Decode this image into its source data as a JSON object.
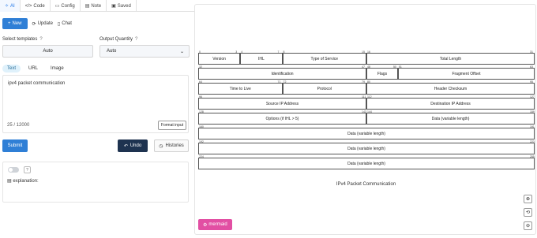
{
  "tabs": [
    {
      "label": "AI",
      "icon": "sparkle-icon"
    },
    {
      "label": "Code",
      "icon": "code-icon"
    },
    {
      "label": "Config",
      "icon": "folder-icon"
    },
    {
      "label": "Note",
      "icon": "note-icon"
    },
    {
      "label": "Saved",
      "icon": "save-icon"
    }
  ],
  "toolbar": {
    "new_label": "New",
    "update_label": "Update",
    "chat_label": "Chat"
  },
  "templates": {
    "label": "Select templates",
    "value": "Auto"
  },
  "quantity": {
    "label": "Output Quantity",
    "value": "Auto"
  },
  "input_tabs": [
    "Text",
    "URL",
    "Image"
  ],
  "input": {
    "value": "ipv4 packet communication",
    "count": "25 / 12000",
    "format_label": "Format input"
  },
  "actions": {
    "submit": "Submit",
    "undo": "Undo",
    "histories": "Histories"
  },
  "explanation": {
    "label": "explanation:"
  },
  "diagram": {
    "caption": "IPv4 Packet Communication",
    "rows": [
      {
        "cells": [
          {
            "label": "Version",
            "b1": "0",
            "b2": "3"
          },
          {
            "label": "IHL",
            "b1": "4",
            "b2": "7"
          },
          {
            "label": "Type of Service",
            "b1": "8",
            "b2": "15"
          },
          {
            "label": "Total Length",
            "b1": "16",
            "b2": "31"
          }
        ]
      },
      {
        "cells": [
          {
            "label": "Identification",
            "b1": "32",
            "b2": "47"
          },
          {
            "label": "Flags",
            "b1": "48",
            "b2": "50"
          },
          {
            "label": "Fragment Offset",
            "b1": "51",
            "b2": "63"
          }
        ]
      },
      {
        "cells": [
          {
            "label": "Time to Live",
            "b1": "64",
            "b2": "71"
          },
          {
            "label": "Protocol",
            "b1": "72",
            "b2": "79"
          },
          {
            "label": "Header Checksum",
            "b1": "80",
            "b2": "95"
          }
        ]
      },
      {
        "cells": [
          {
            "label": "Source IP Address",
            "b1": "96",
            "b2": "111"
          },
          {
            "label": "Destination IP Address",
            "b1": "112",
            "b2": "127"
          }
        ]
      },
      {
        "cells": [
          {
            "label": "Options (if IHL > 5)",
            "b1": "128",
            "b2": "143"
          },
          {
            "label": "Data (variable length)",
            "b1": "144",
            "b2": "159"
          }
        ]
      },
      {
        "cells": [
          {
            "label": "Data (variable length)",
            "b1": "160",
            "b2": "191"
          }
        ]
      },
      {
        "cells": [
          {
            "label": "Data (variable length)",
            "b1": "192",
            "b2": "223"
          }
        ]
      },
      {
        "cells": [
          {
            "label": "Data (variable length)",
            "b1": "224",
            "b2": "255"
          }
        ]
      }
    ]
  },
  "mermaid_label": "mermaid"
}
